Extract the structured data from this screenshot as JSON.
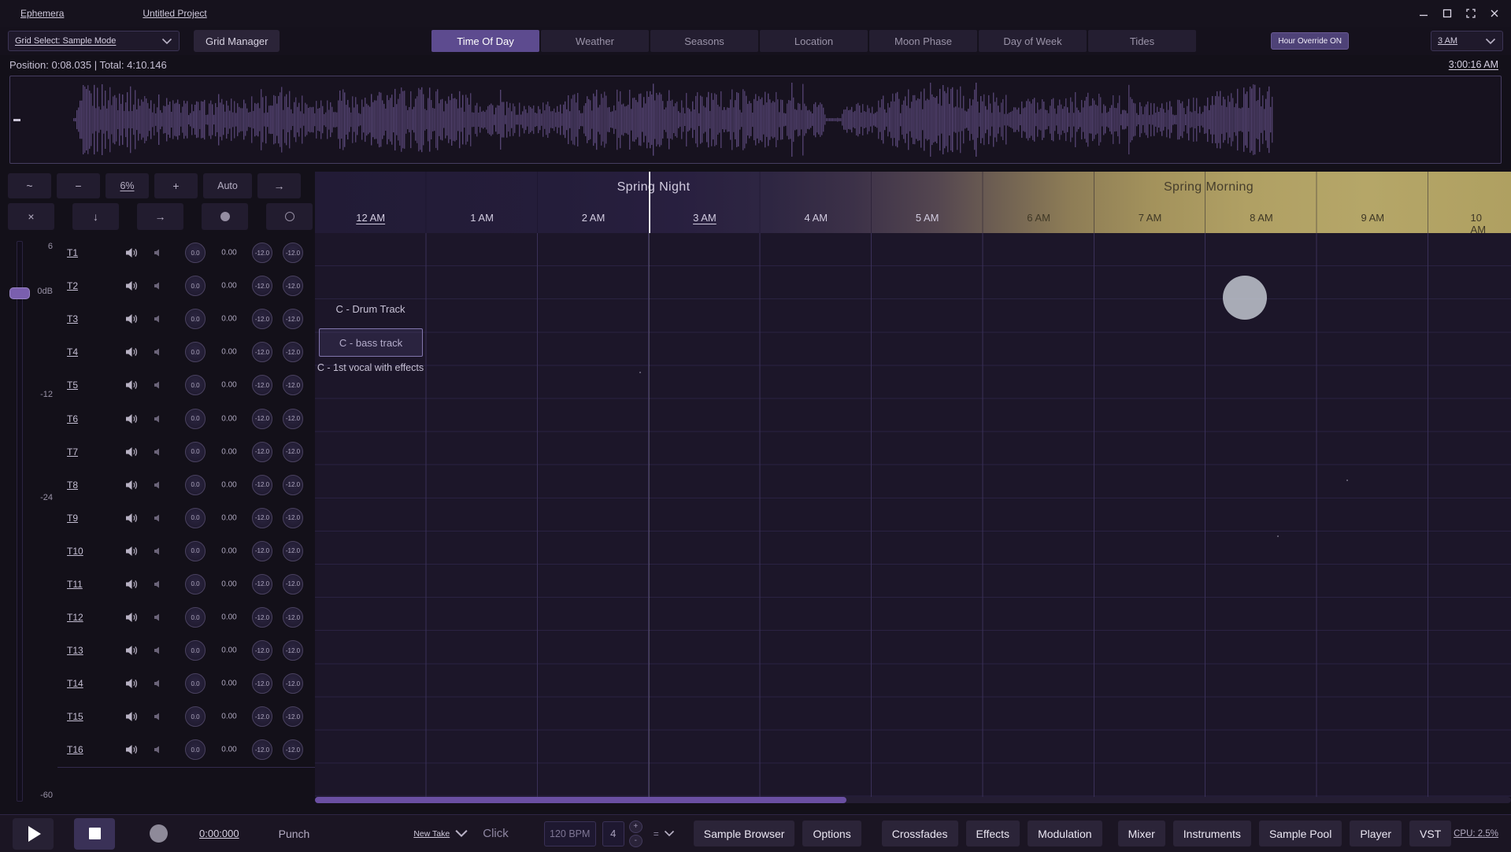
{
  "colors": {
    "accent": "#6a4fa2",
    "tab_active": "#5d4b8f",
    "waveform": "#5a4879",
    "night": "#241d3a",
    "morning": "#b0a062"
  },
  "icons": {
    "wave_zoom": "~",
    "zoom_out": "−",
    "zoom_in": "+",
    "arrow_right": "→",
    "close": "×",
    "arrow_down": "↓",
    "step_plus": "+",
    "step_minus": "-"
  },
  "titlebar": {
    "app_name": "Ephemera",
    "project_name": "Untitled Project"
  },
  "toolbar": {
    "grid_select_label": "Grid Select: Sample Mode",
    "grid_manager_label": "Grid Manager",
    "tabs": [
      {
        "label": "Time Of Day",
        "active": true
      },
      {
        "label": "Weather",
        "active": false
      },
      {
        "label": "Seasons",
        "active": false
      },
      {
        "label": "Location",
        "active": false
      },
      {
        "label": "Moon Phase",
        "active": false
      },
      {
        "label": "Day of Week",
        "active": false
      },
      {
        "label": "Tides",
        "active": false
      }
    ],
    "hour_override_label": "Hour Override ON",
    "hour_select_value": "3 AM"
  },
  "statusbar": {
    "position_text": "Position: 0:08.035 | Total: 4:10.146",
    "clock_text": "3:00:16 AM"
  },
  "zoom_controls": {
    "zoom_level": "6%",
    "auto_label": "Auto"
  },
  "timeline": {
    "period_labels": [
      "Spring Night",
      "Spring Morning"
    ],
    "hours": [
      "12 AM",
      "1 AM",
      "2 AM",
      "3 AM",
      "4 AM",
      "5 AM",
      "6 AM",
      "7 AM",
      "8 AM",
      "9 AM",
      "10 AM"
    ],
    "underlined_hours": [
      "12 AM",
      "3 AM"
    ]
  },
  "grid": {
    "row_labels": [
      "C - Drum Track",
      "C - bass track",
      "C - 1st vocal with effects"
    ],
    "selected_row": "C - bass track"
  },
  "mixer": {
    "meter_labels": [
      "6",
      "0dB",
      "-12",
      "-24",
      "-60"
    ],
    "tracks": [
      {
        "name": "T1",
        "gain": "0.0",
        "pan": "0.00",
        "send_a": "-12.0",
        "send_b": "-12.0"
      },
      {
        "name": "T2",
        "gain": "0.0",
        "pan": "0.00",
        "send_a": "-12.0",
        "send_b": "-12.0"
      },
      {
        "name": "T3",
        "gain": "0.0",
        "pan": "0.00",
        "send_a": "-12.0",
        "send_b": "-12.0"
      },
      {
        "name": "T4",
        "gain": "0.0",
        "pan": "0.00",
        "send_a": "-12.0",
        "send_b": "-12.0"
      },
      {
        "name": "T5",
        "gain": "0.0",
        "pan": "0.00",
        "send_a": "-12.0",
        "send_b": "-12.0"
      },
      {
        "name": "T6",
        "gain": "0.0",
        "pan": "0.00",
        "send_a": "-12.0",
        "send_b": "-12.0"
      },
      {
        "name": "T7",
        "gain": "0.0",
        "pan": "0.00",
        "send_a": "-12.0",
        "send_b": "-12.0"
      },
      {
        "name": "T8",
        "gain": "0.0",
        "pan": "0.00",
        "send_a": "-12.0",
        "send_b": "-12.0"
      },
      {
        "name": "T9",
        "gain": "0.0",
        "pan": "0.00",
        "send_a": "-12.0",
        "send_b": "-12.0"
      },
      {
        "name": "T10",
        "gain": "0.0",
        "pan": "0.00",
        "send_a": "-12.0",
        "send_b": "-12.0"
      },
      {
        "name": "T11",
        "gain": "0.0",
        "pan": "0.00",
        "send_a": "-12.0",
        "send_b": "-12.0"
      },
      {
        "name": "T12",
        "gain": "0.0",
        "pan": "0.00",
        "send_a": "-12.0",
        "send_b": "-12.0"
      },
      {
        "name": "T13",
        "gain": "0.0",
        "pan": "0.00",
        "send_a": "-12.0",
        "send_b": "-12.0"
      },
      {
        "name": "T14",
        "gain": "0.0",
        "pan": "0.00",
        "send_a": "-12.0",
        "send_b": "-12.0"
      },
      {
        "name": "T15",
        "gain": "0.0",
        "pan": "0.00",
        "send_a": "-12.0",
        "send_b": "-12.0"
      },
      {
        "name": "T16",
        "gain": "0.0",
        "pan": "0.00",
        "send_a": "-12.0",
        "send_b": "-12.0"
      }
    ]
  },
  "transport": {
    "time_display": "0:00:000",
    "punch_label": "Punch",
    "take_label": "New Take",
    "click_label": "Click",
    "bpm_label": "120 BPM",
    "beats_value": "4",
    "note_value": "=",
    "panel_buttons": [
      "Sample Browser",
      "Options",
      "Crossfades",
      "Effects",
      "Modulation",
      "Mixer",
      "Instruments",
      "Sample Pool",
      "Player",
      "VST"
    ],
    "cpu_label": "CPU: 2.5%"
  }
}
